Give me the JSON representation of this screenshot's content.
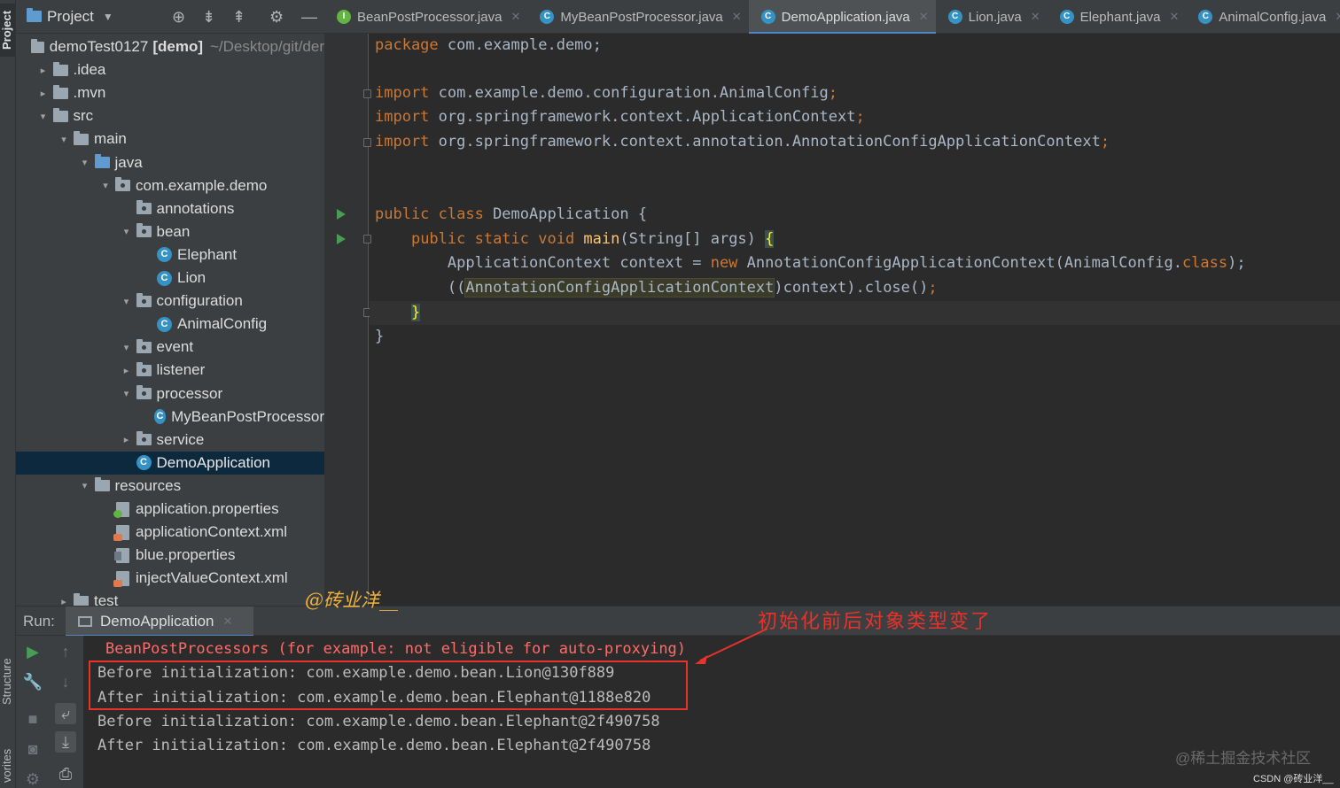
{
  "left_strip": {
    "project_tab": "Project",
    "structure_tab": "Structure",
    "favorites_tab": "vorites"
  },
  "project_panel": {
    "title": "Project",
    "tree": [
      {
        "label": "demoTest0127",
        "bold": "[demo]",
        "muted": "~/Desktop/git/der",
        "icon": "module-icon",
        "indent": 0,
        "chevron": ""
      },
      {
        "label": ".idea",
        "icon": "folder-icon",
        "indent": 1,
        "chevron": "›"
      },
      {
        "label": ".mvn",
        "icon": "folder-icon",
        "indent": 1,
        "chevron": "›"
      },
      {
        "label": "src",
        "icon": "folder-icon",
        "indent": 1,
        "chevron": "⌄"
      },
      {
        "label": "main",
        "icon": "folder-icon",
        "indent": 2,
        "chevron": "⌄"
      },
      {
        "label": "java",
        "icon": "source-folder-icon",
        "indent": 3,
        "chevron": "⌄"
      },
      {
        "label": "com.example.demo",
        "icon": "package-icon",
        "indent": 4,
        "chevron": "⌄"
      },
      {
        "label": "annotations",
        "icon": "package-icon",
        "indent": 5,
        "chevron": ""
      },
      {
        "label": "bean",
        "icon": "package-icon",
        "indent": 5,
        "chevron": "⌄"
      },
      {
        "label": "Elephant",
        "icon": "class-icon",
        "indent": 6,
        "chevron": ""
      },
      {
        "label": "Lion",
        "icon": "class-icon",
        "indent": 6,
        "chevron": ""
      },
      {
        "label": "configuration",
        "icon": "package-icon",
        "indent": 5,
        "chevron": "⌄"
      },
      {
        "label": "AnimalConfig",
        "icon": "class-icon",
        "indent": 6,
        "chevron": ""
      },
      {
        "label": "event",
        "icon": "package-icon",
        "indent": 5,
        "chevron": "⌄"
      },
      {
        "label": "listener",
        "icon": "package-icon",
        "indent": 5,
        "chevron": "›"
      },
      {
        "label": "processor",
        "icon": "package-icon",
        "indent": 5,
        "chevron": "⌄"
      },
      {
        "label": "MyBeanPostProcessor",
        "icon": "class-icon",
        "indent": 6,
        "chevron": ""
      },
      {
        "label": "service",
        "icon": "package-icon",
        "indent": 5,
        "chevron": "›"
      },
      {
        "label": "DemoApplication",
        "icon": "class-icon",
        "indent": 5,
        "chevron": "",
        "selected": true
      },
      {
        "label": "resources",
        "icon": "resources-folder-icon",
        "indent": 3,
        "chevron": "⌄"
      },
      {
        "label": "application.properties",
        "icon": "spring-properties-icon",
        "indent": 4,
        "chevron": ""
      },
      {
        "label": "applicationContext.xml",
        "icon": "xml-file-icon",
        "indent": 4,
        "chevron": ""
      },
      {
        "label": "blue.properties",
        "icon": "properties-file-icon",
        "indent": 4,
        "chevron": ""
      },
      {
        "label": "injectValueContext.xml",
        "icon": "xml-file-icon",
        "indent": 4,
        "chevron": ""
      },
      {
        "label": "test",
        "icon": "folder-icon",
        "indent": 2,
        "chevron": "›"
      }
    ]
  },
  "tabs": [
    {
      "label": "BeanPostProcessor.java",
      "icon": "interface-icon",
      "active": false
    },
    {
      "label": "MyBeanPostProcessor.java",
      "icon": "class-icon",
      "active": false
    },
    {
      "label": "DemoApplication.java",
      "icon": "class-icon",
      "active": true
    },
    {
      "label": "Lion.java",
      "icon": "class-icon",
      "active": false
    },
    {
      "label": "Elephant.java",
      "icon": "class-icon",
      "active": false
    },
    {
      "label": "AnimalConfig.java",
      "icon": "class-icon",
      "active": false
    }
  ],
  "code": {
    "line_package": "com.example.demo;",
    "import1": "com.example.demo.configuration.AnimalConfig",
    "import2": "org.springframework.context.ApplicationContext",
    "import3": "org.springframework.context.annotation.AnnotationConfigApplicationContext",
    "class_name": "DemoApplication",
    "main_params": "(String[] args) ",
    "stmt1_type": "ApplicationContext context = ",
    "stmt1_rest": "AnnotationConfigApplicationContext(AnimalConfig.",
    "stmt2_pre": "((",
    "stmt2_cast": "AnnotationConfigApplicationContext",
    "stmt2_post": ")context).close()"
  },
  "run_panel": {
    "label": "Run:",
    "tab_label": "DemoApplication",
    "console_lines": [
      {
        "text": "BeanPostProcessors (for example: not eligible for auto-proxying)",
        "type": "err"
      },
      {
        "text": "Before initialization: com.example.demo.bean.Lion@130f889",
        "type": "out"
      },
      {
        "text": "After initialization: com.example.demo.bean.Elephant@1188e820",
        "type": "out"
      },
      {
        "text": "Before initialization: com.example.demo.bean.Elephant@2f490758",
        "type": "out"
      },
      {
        "text": "After initialization: com.example.demo.bean.Elephant@2f490758",
        "type": "out"
      }
    ]
  },
  "annotations": {
    "author": "@砖业洋__",
    "note": "初始化前后对象类型变了",
    "watermark": "@稀土掘金技术社区",
    "csdn": "CSDN @砖业洋__"
  },
  "colors": {
    "accent": "#4a88c7",
    "highlight_red": "#e8322a",
    "keyword": "#cc7832",
    "method": "#ffc66d",
    "error_text": "#ff6b68"
  }
}
